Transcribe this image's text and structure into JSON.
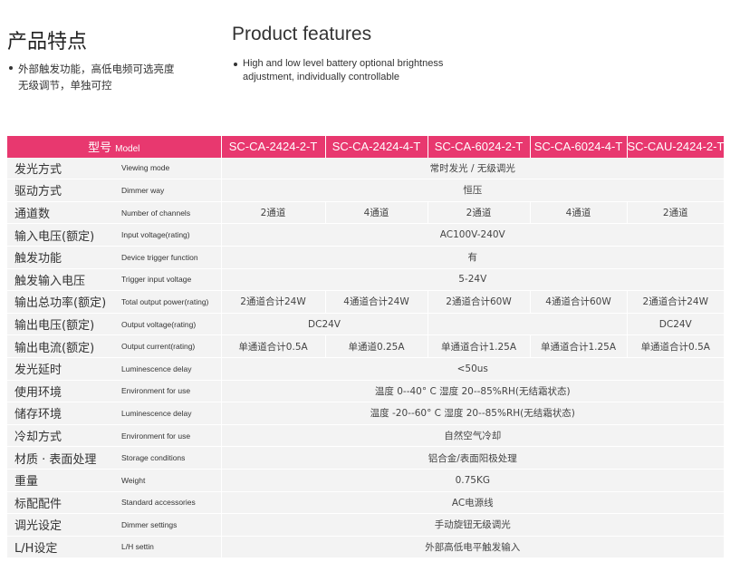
{
  "heading": {
    "cn": "产品特点",
    "en": "Product features",
    "bullet_cn": "外部触发功能，高低电频可选亮度无级调节，单独可控",
    "bullet_en": "High and low level battery optional brightness adjustment, individually controllable"
  },
  "table": {
    "header_cn": "型号",
    "header_en": "Model",
    "models": [
      "SC-CA-2424-2-T",
      "SC-CA-2424-4-T",
      "SC-CA-6024-2-T",
      "SC-CA-6024-4-T",
      "SC-CAU-2424-2-T"
    ],
    "rows": [
      {
        "cn": "发光方式",
        "en": "Viewing mode",
        "cells": [
          {
            "v": "常时发光 / 无级调光",
            "span": 5
          }
        ]
      },
      {
        "cn": "驱动方式",
        "en": "Dimmer way",
        "cells": [
          {
            "v": "恒压",
            "span": 5
          }
        ]
      },
      {
        "cn": "通道数",
        "en": "Number of channels",
        "cells": [
          {
            "v": "2通道",
            "span": 1
          },
          {
            "v": "4通道",
            "span": 1
          },
          {
            "v": "2通道",
            "span": 1
          },
          {
            "v": "4通道",
            "span": 1
          },
          {
            "v": "2通道",
            "span": 1
          }
        ]
      },
      {
        "cn": "输入电压(额定)",
        "en": "Input voltage(rating)",
        "cells": [
          {
            "v": "AC100V-240V",
            "span": 5
          }
        ]
      },
      {
        "cn": "触发功能",
        "en": "Device trigger function",
        "cells": [
          {
            "v": "有",
            "span": 5
          }
        ]
      },
      {
        "cn": "触发输入电压",
        "en": "Trigger input voltage",
        "cells": [
          {
            "v": "5-24V",
            "span": 5
          }
        ]
      },
      {
        "cn": "输出总功率(额定)",
        "en": "Total output power(rating)",
        "cells": [
          {
            "v": "2通道合计24W",
            "span": 1
          },
          {
            "v": "4通道合计24W",
            "span": 1
          },
          {
            "v": "2通道合计60W",
            "span": 1
          },
          {
            "v": "4通道合计60W",
            "span": 1
          },
          {
            "v": "2通道合计24W",
            "span": 1
          }
        ]
      },
      {
        "cn": "输出电压(额定)",
        "en": "Output voltage(rating)",
        "cells": [
          {
            "v": "DC24V",
            "span": 2
          },
          {
            "v": "",
            "span": 2
          },
          {
            "v": "DC24V",
            "span": 1
          }
        ]
      },
      {
        "cn": "输出电流(额定)",
        "en": "Output current(rating)",
        "cells": [
          {
            "v": "单通道合计0.5A",
            "span": 1
          },
          {
            "v": "单通道0.25A",
            "span": 1
          },
          {
            "v": "单通道合计1.25A",
            "span": 1
          },
          {
            "v": "单通道合计1.25A",
            "span": 1
          },
          {
            "v": "单通道合计0.5A",
            "span": 1
          }
        ]
      },
      {
        "cn": "发光延时",
        "en": "Luminescence delay",
        "cells": [
          {
            "v": "<50us",
            "span": 5
          }
        ]
      },
      {
        "cn": "使用环境",
        "en": "Environment for use",
        "cells": [
          {
            "v": "温度 0--40°  C   湿度 20--85%RH(无结霜状态)",
            "span": 5
          }
        ]
      },
      {
        "cn": "储存环境",
        "en": "Luminescence delay",
        "cells": [
          {
            "v": "温度 -20--60°  C   湿度 20--85%RH(无结霜状态)",
            "span": 5
          }
        ]
      },
      {
        "cn": "冷却方式",
        "en": "Environment for use",
        "cells": [
          {
            "v": "自然空气冷却",
            "span": 5
          }
        ]
      },
      {
        "cn": "材质 · 表面处理",
        "en": "Storage conditions",
        "cells": [
          {
            "v": "铝合金/表面阳极处理",
            "span": 5
          }
        ]
      },
      {
        "cn": "重量",
        "en": "Weight",
        "cells": [
          {
            "v": "0.75KG",
            "span": 5
          }
        ]
      },
      {
        "cn": "标配配件",
        "en": "Standard accessories",
        "cells": [
          {
            "v": "AC电源线",
            "span": 5
          }
        ]
      },
      {
        "cn": "调光设定",
        "en": "Dimmer settings",
        "cells": [
          {
            "v": "手动旋钮无级调光",
            "span": 5
          }
        ]
      },
      {
        "cn": "L/H设定",
        "en": "L/H settin",
        "cells": [
          {
            "v": "外部高低电平触发输入",
            "span": 5
          }
        ]
      }
    ]
  }
}
